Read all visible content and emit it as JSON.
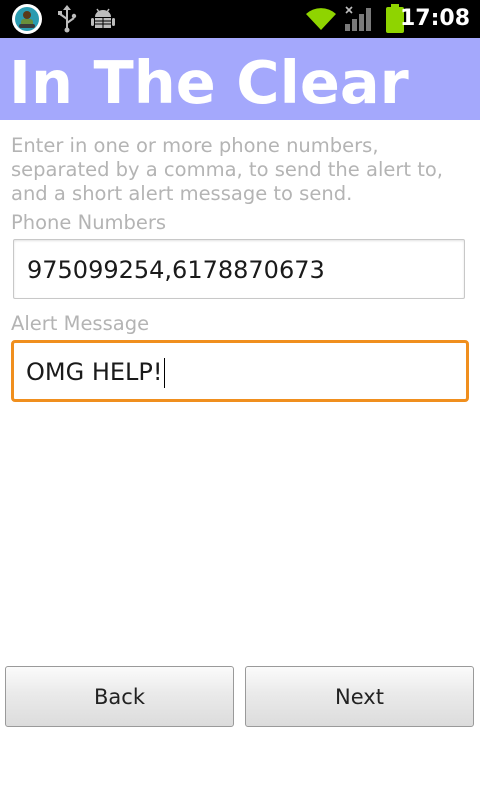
{
  "status_bar": {
    "time": "17:08",
    "icons": [
      "app-notification-icon",
      "usb-icon",
      "android-debug-icon",
      "wifi-icon",
      "signal-icon",
      "battery-icon"
    ],
    "battery_color": "#8fd400",
    "wifi_color": "#8fd400"
  },
  "header": {
    "title": "In The Clear",
    "background_color": "#a4a8fc"
  },
  "form": {
    "instructions": "Enter in one or more phone numbers, separated by a comma, to send the alert to, and a short alert message to send.",
    "phone_label": "Phone Numbers",
    "phone_value": "975099254,6178870673",
    "message_label": "Alert Message",
    "message_value": "OMG HELP!",
    "focus_color": "#f08f1e"
  },
  "buttons": {
    "back_label": "Back",
    "next_label": "Next"
  }
}
